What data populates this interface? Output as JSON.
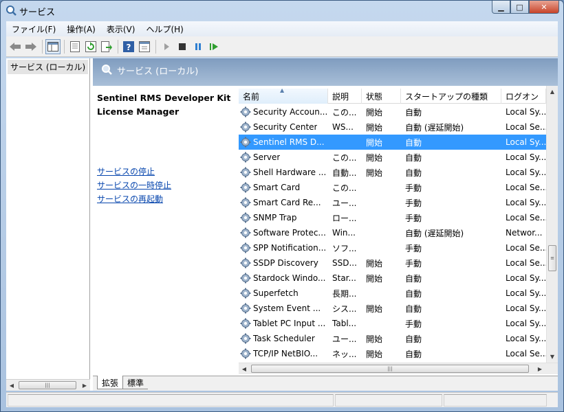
{
  "window": {
    "title": "サービス"
  },
  "menu": [
    "ファイル(F)",
    "操作(A)",
    "表示(V)",
    "ヘルプ(H)"
  ],
  "toolbar": {
    "buttons": [
      "back-icon",
      "forward-icon",
      "console-tree-icon",
      "properties-icon",
      "refresh-icon",
      "export-list-icon",
      "help-icon",
      "view-icon",
      "start-service-icon",
      "stop-service-icon",
      "pause-service-icon",
      "restart-service-icon"
    ]
  },
  "tree": {
    "root": "サービス (ローカル)"
  },
  "main_header": {
    "title": "サービス (ローカル)"
  },
  "details": {
    "service_name": "Sentinel RMS Developer Kit License Manager",
    "actions": [
      "サービスの停止",
      "サービスの一時停止",
      "サービスの再起動"
    ]
  },
  "columns": [
    "名前",
    "説明",
    "状態",
    "スタートアップの種類",
    "ログオン"
  ],
  "services": [
    {
      "name": "Security Accoun...",
      "desc": "この...",
      "state": "開始",
      "startup": "自動",
      "logon": "Local Sy..."
    },
    {
      "name": "Security Center",
      "desc": "WS...",
      "state": "開始",
      "startup": "自動 (遅延開始)",
      "logon": "Local Se..."
    },
    {
      "name": "Sentinel RMS D...",
      "desc": "",
      "state": "開始",
      "startup": "自動",
      "logon": "Local Sy..."
    },
    {
      "name": "Server",
      "desc": "この...",
      "state": "開始",
      "startup": "自動",
      "logon": "Local Sy..."
    },
    {
      "name": "Shell Hardware ...",
      "desc": "自動...",
      "state": "開始",
      "startup": "自動",
      "logon": "Local Sy..."
    },
    {
      "name": "Smart Card",
      "desc": "この...",
      "state": "",
      "startup": "手動",
      "logon": "Local Se..."
    },
    {
      "name": "Smart Card Re...",
      "desc": "ユー...",
      "state": "",
      "startup": "手動",
      "logon": "Local Sy..."
    },
    {
      "name": "SNMP Trap",
      "desc": "ロー...",
      "state": "",
      "startup": "手動",
      "logon": "Local Se..."
    },
    {
      "name": "Software Protec...",
      "desc": "Win...",
      "state": "",
      "startup": "自動 (遅延開始)",
      "logon": "Networ..."
    },
    {
      "name": "SPP Notification...",
      "desc": "ソフ...",
      "state": "",
      "startup": "手動",
      "logon": "Local Se..."
    },
    {
      "name": "SSDP Discovery",
      "desc": "SSD...",
      "state": "開始",
      "startup": "手動",
      "logon": "Local Se..."
    },
    {
      "name": "Stardock Windo...",
      "desc": "Star...",
      "state": "開始",
      "startup": "自動",
      "logon": "Local Sy..."
    },
    {
      "name": "Superfetch",
      "desc": "長期...",
      "state": "",
      "startup": "自動",
      "logon": "Local Sy..."
    },
    {
      "name": "System Event ...",
      "desc": "シス...",
      "state": "開始",
      "startup": "自動",
      "logon": "Local Sy..."
    },
    {
      "name": "Tablet PC Input ...",
      "desc": "Tabl...",
      "state": "",
      "startup": "手動",
      "logon": "Local Sy..."
    },
    {
      "name": "Task Scheduler",
      "desc": "ユー...",
      "state": "開始",
      "startup": "自動",
      "logon": "Local Sy..."
    },
    {
      "name": "TCP/IP NetBIO...",
      "desc": "ネッ...",
      "state": "開始",
      "startup": "自動",
      "logon": "Local Se..."
    }
  ],
  "selected_index": 2,
  "tabs": [
    "拡張",
    "標準"
  ],
  "colors": {
    "selection": "#3399ff",
    "link": "#0645ad",
    "header_band": "#8aa6c6"
  }
}
